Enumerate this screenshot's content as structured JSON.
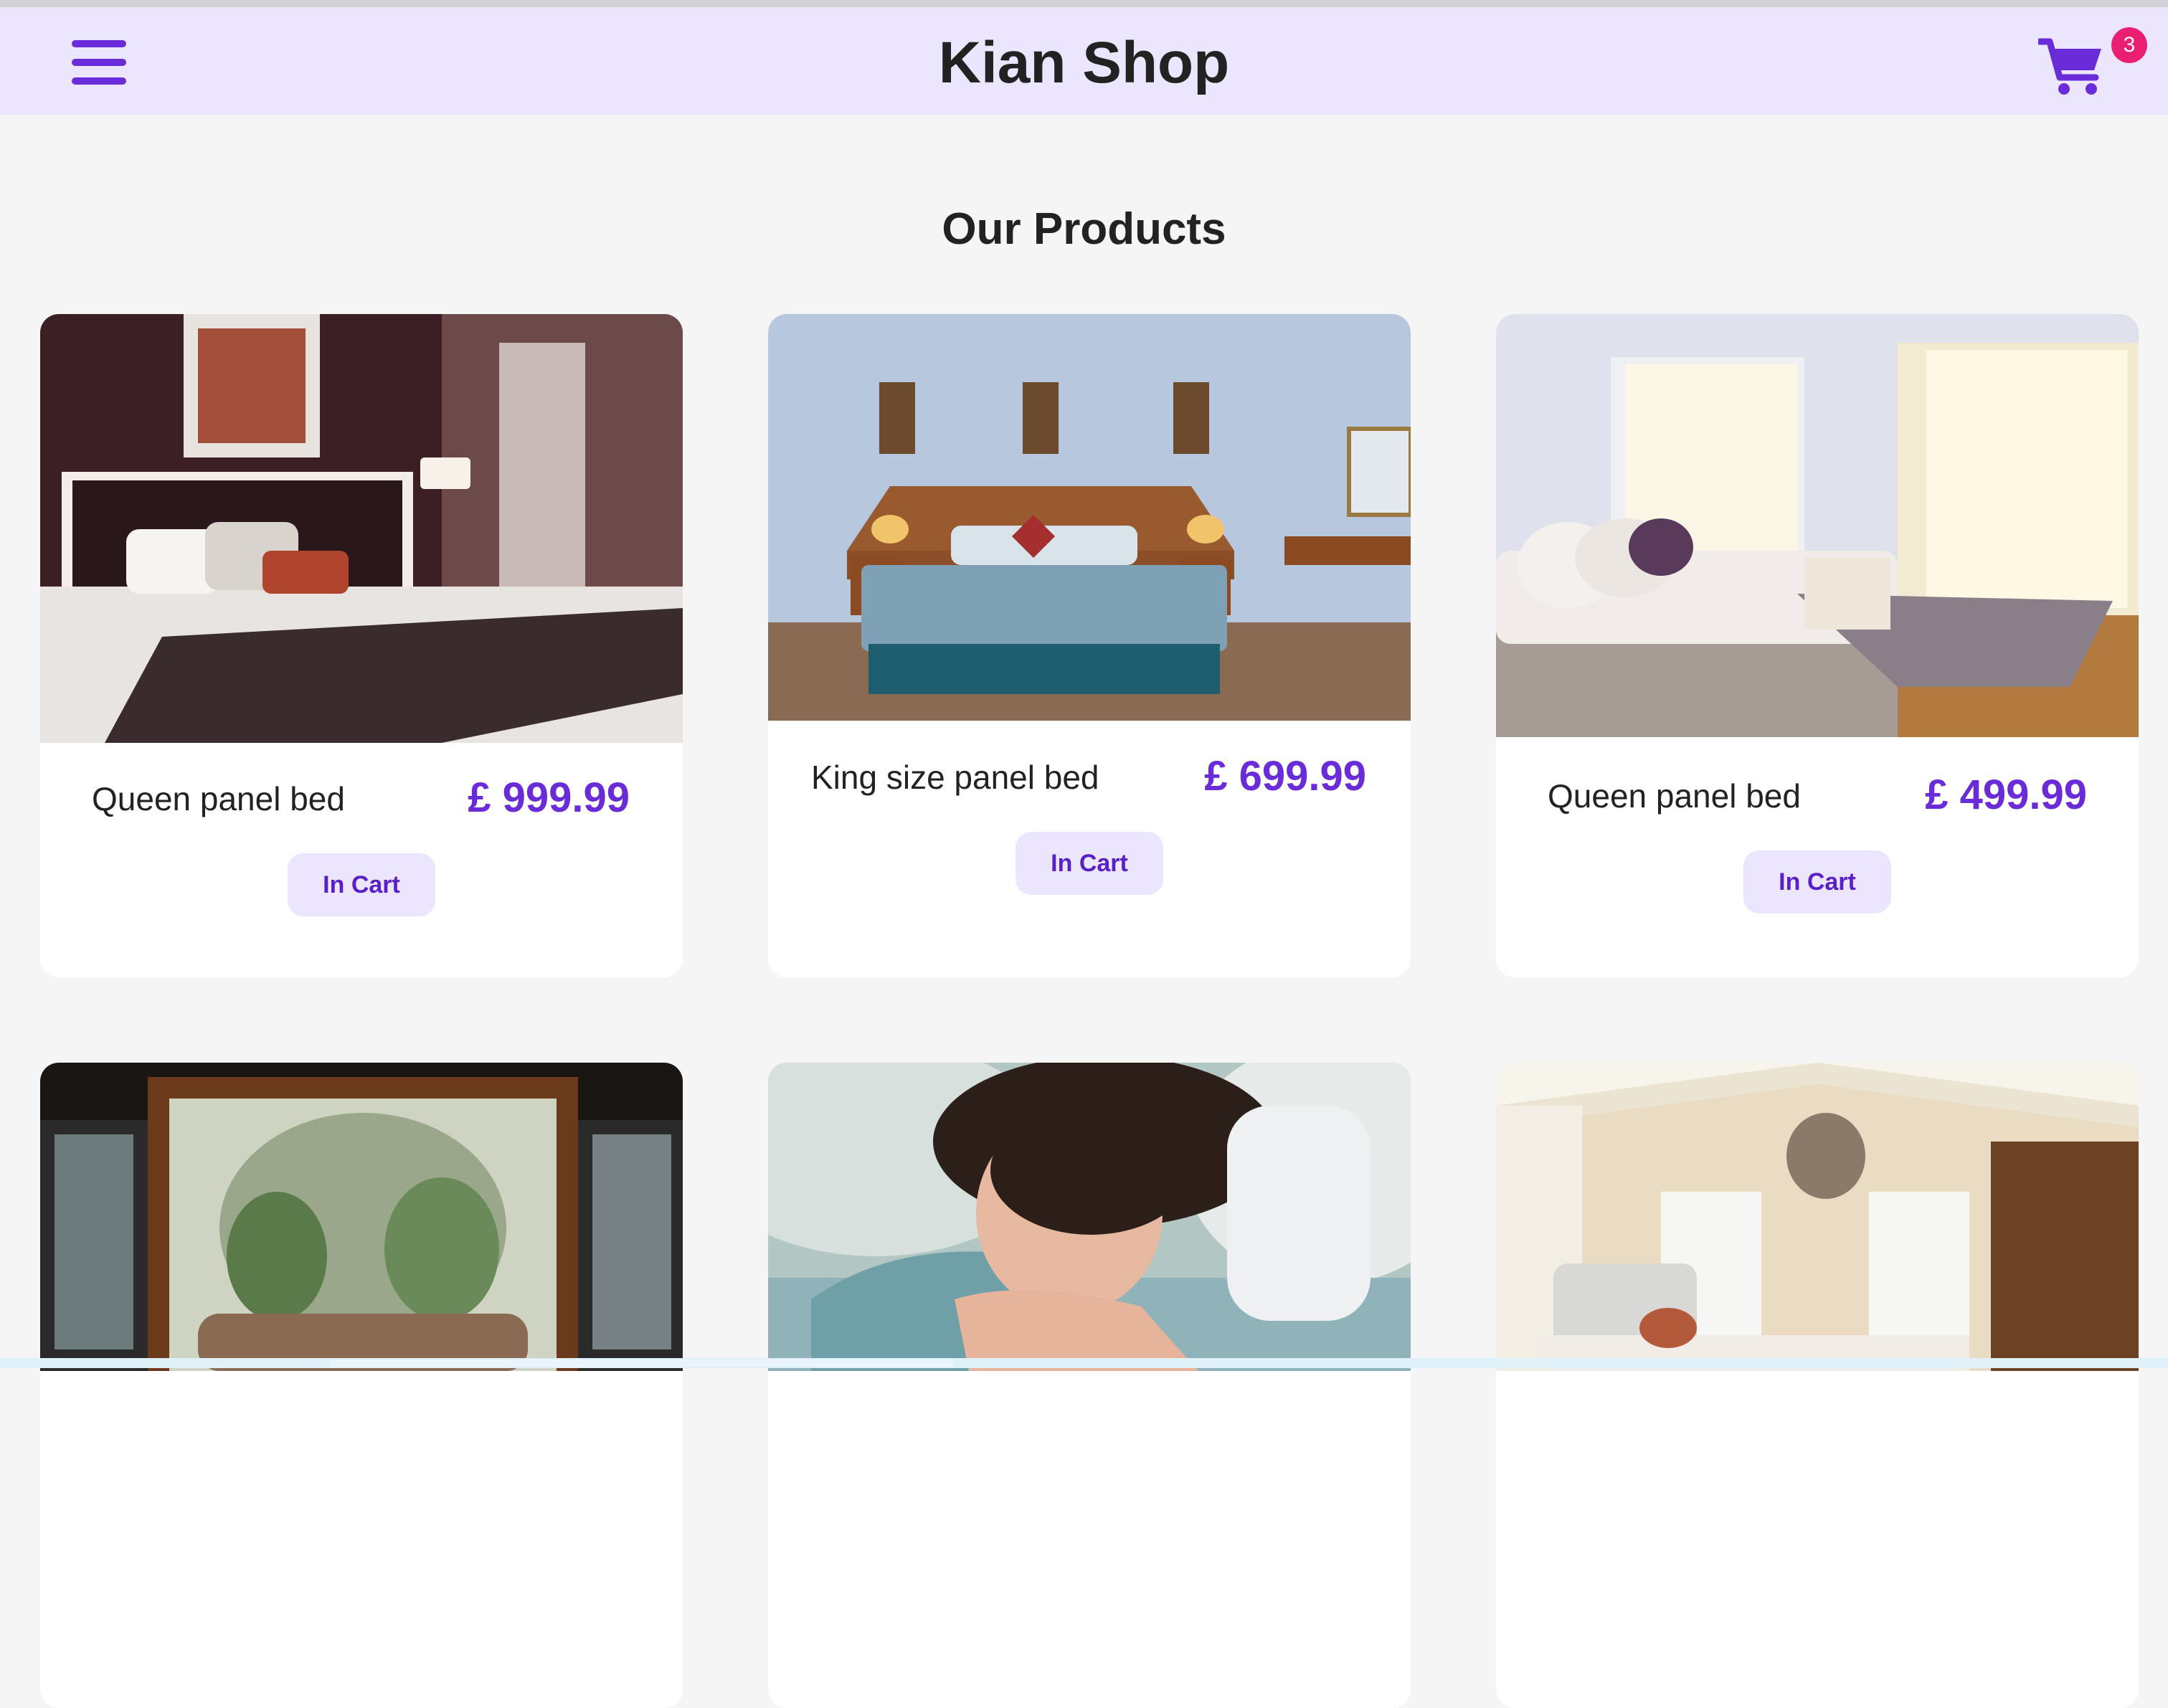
{
  "header": {
    "title": "Kian Shop",
    "menu_icon": "hamburger-menu-icon",
    "cart_icon": "shopping-cart-icon",
    "cart_count": "3",
    "accent_color": "#6a2bd8",
    "header_bg": "#ebe5fe",
    "badge_color": "#ea1f71"
  },
  "main": {
    "section_title": "Our Products",
    "products": [
      {
        "name": "Queen panel bed",
        "price": "£ 999.99",
        "button": "In Cart",
        "image": "dark-hotel-bedroom-photo"
      },
      {
        "name": "King size panel bed",
        "price": "£ 699.99",
        "button": "In Cart",
        "image": "blue-bedroom-with-lamps-photo"
      },
      {
        "name": "Queen panel bed",
        "price": "£ 499.99",
        "button": "In Cart",
        "image": "bright-bedroom-curtains-photo"
      },
      {
        "image": "canopy-bed-plants-photo"
      },
      {
        "image": "woman-sleeping-photo"
      },
      {
        "image": "vaulted-ceiling-bedroom-photo"
      }
    ]
  }
}
